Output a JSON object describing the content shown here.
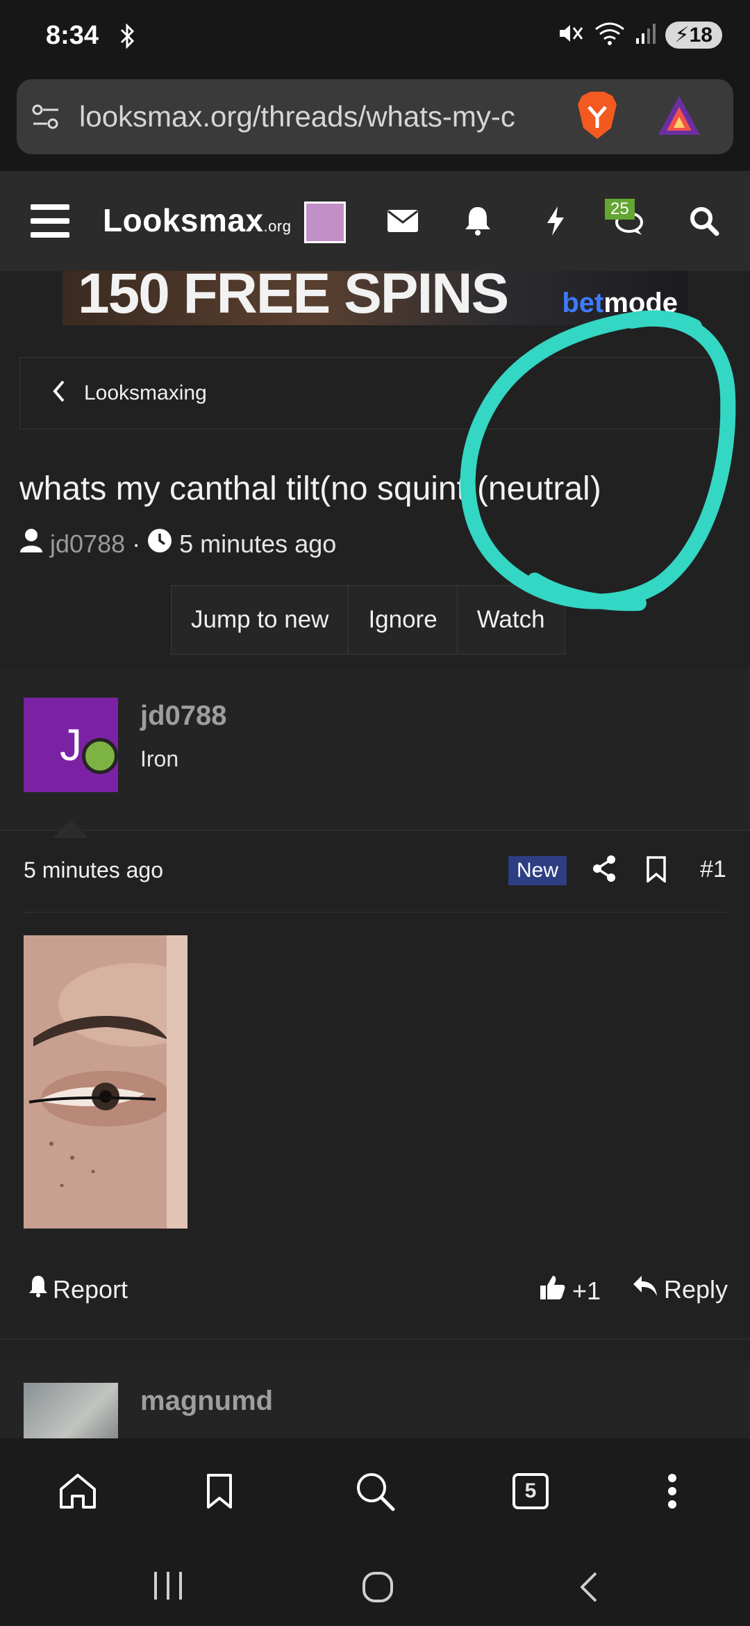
{
  "status_bar": {
    "time": "8:34",
    "battery": "18"
  },
  "browser": {
    "url": "looksmax.org/threads/whats-my-c",
    "tab_count": "5"
  },
  "site": {
    "logo": "Looksmax",
    "logo_suffix": ".org",
    "notification_badge": "25"
  },
  "banner": {
    "text": "150 FREE SPINS",
    "brand_prefix": "bet",
    "brand_suffix": "mode"
  },
  "breadcrumb": {
    "label": "Looksmaxing"
  },
  "thread": {
    "title": "whats my canthal tilt(no squint)(neutral)",
    "author": "jd0788",
    "time": "5 minutes ago",
    "buttons": [
      "Jump to new",
      "Ignore",
      "Watch"
    ]
  },
  "post": {
    "avatar_letter": "J",
    "username": "jd0788",
    "rank": "Iron",
    "time": "5 minutes ago",
    "new_badge": "New",
    "number": "#1",
    "report_label": "Report",
    "like_label": "+1",
    "reply_label": "Reply"
  },
  "post2": {
    "username": "magnumd"
  },
  "colors": {
    "background": "#212121",
    "avatar": "#7b22a4",
    "online": "#7cb342",
    "new_badge": "#2d3e83",
    "annotation": "#34d6c4",
    "header_badge": "#63a633"
  }
}
